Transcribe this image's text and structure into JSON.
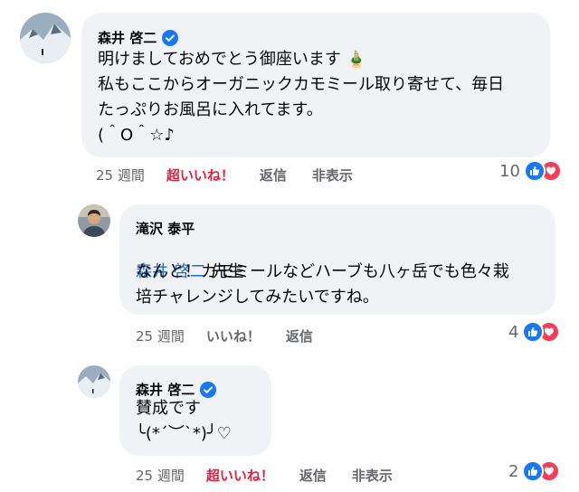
{
  "comments": [
    {
      "author": "森井 啓二",
      "mention": "",
      "text": "明けましておめでとう御座います 🎍\n私もここからオーガニックカモミール取り寄せて、毎日\nたっぷりお風呂に入れてます。\n(＾O＾☆♪",
      "time": "25 週間",
      "like_label": "超いいね！",
      "reply_label": "返信",
      "hide_label": "非表示",
      "reaction_count": "10"
    },
    {
      "author": "滝沢 泰平",
      "mention": "森井 啓二",
      "mention_suffix": " 先生",
      "text": "なんと！カモミールなどハーブも八ヶ岳でも色々栽\n培チャレンジしてみたいですね。",
      "time": "25 週間",
      "like_label": "いいね！",
      "reply_label": "返信",
      "reaction_count": "4"
    },
    {
      "author": "森井 啓二",
      "text": "賛成です\n╰(*´︶`*)╯♡",
      "time": "25 週間",
      "like_label": "超いいね！",
      "reply_label": "返信",
      "hide_label": "非表示",
      "reaction_count": "2"
    }
  ],
  "icons": {
    "verified": "verified-badge-icon",
    "like": "thumbs-up-icon",
    "love": "heart-icon"
  },
  "colors": {
    "bubble": "#f0f2f5",
    "like_blue": "#1877f2",
    "love_red": "#f33e58",
    "super_like_text": "#e41e3f",
    "mention": "#1a6fd6"
  }
}
